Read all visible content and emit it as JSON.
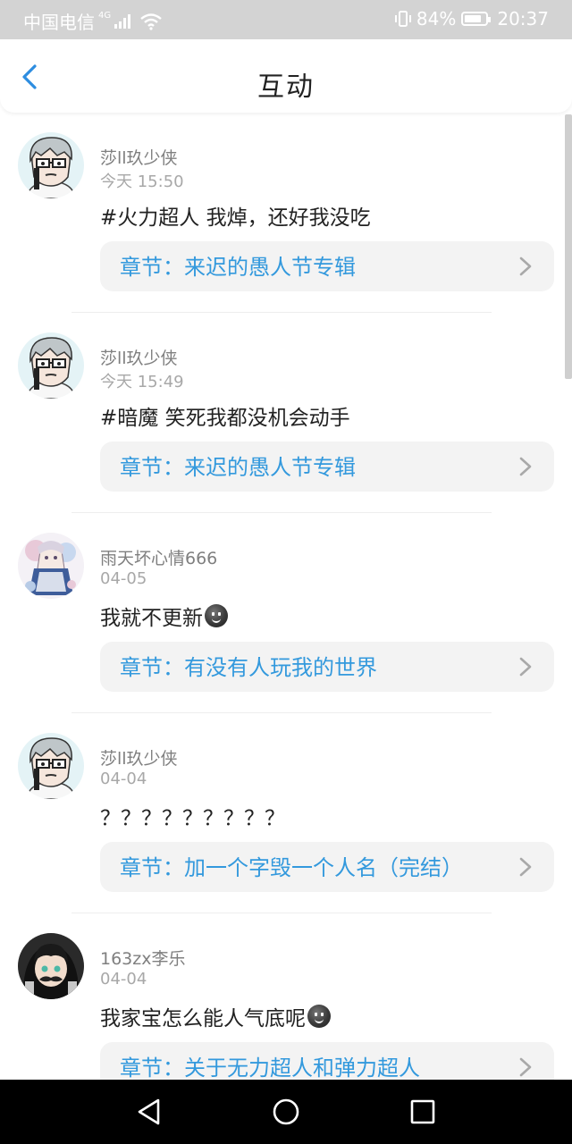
{
  "status_bar": {
    "carrier": "中国电信",
    "network": "4G",
    "battery": "84%",
    "time": "20:37"
  },
  "header": {
    "title": "互动"
  },
  "comments": [
    {
      "username": "莎ll玖少侠",
      "time": "今天 15:50",
      "text": "#火力超人 我焯，还好我没吃",
      "has_emoji": false,
      "chapter": "章节：来迟的愚人节专辑",
      "avatar": "avatar-shaqi"
    },
    {
      "username": "莎ll玖少侠",
      "time": "今天 15:49",
      "text": "#暗魔 笑死我都没机会动手",
      "has_emoji": false,
      "chapter": "章节：来迟的愚人节专辑",
      "avatar": "avatar-shaqi"
    },
    {
      "username": "雨天坏心情666",
      "time": "04-05",
      "text": "我就不更新",
      "has_emoji": true,
      "chapter": "章节：有没有人玩我的世界",
      "avatar": "avatar-yutian"
    },
    {
      "username": "莎ll玖少侠",
      "time": "04-04",
      "text": "？？？？？？？？？",
      "has_emoji": false,
      "chapter": "章节：加一个字毁一个人名（完结）",
      "avatar": "avatar-shaqi"
    },
    {
      "username": "163zx李乐",
      "time": "04-04",
      "text": "我家宝怎么能人气底呢",
      "has_emoji": true,
      "chapter": "章节：关于无力超人和弹力超人",
      "avatar": "avatar-lile"
    }
  ],
  "colors": {
    "link": "#3399dd",
    "back_arrow": "#2d8de0"
  }
}
